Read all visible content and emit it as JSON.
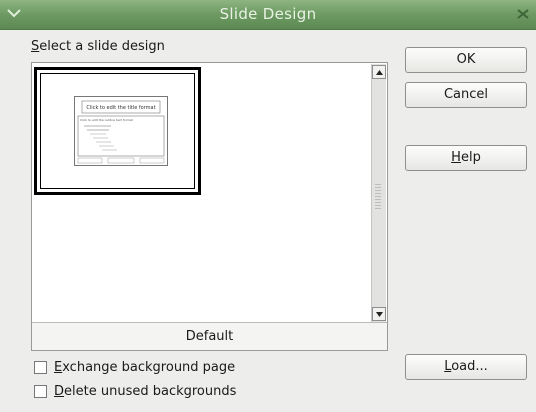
{
  "window": {
    "title": "Slide Design",
    "menu_icon": "window-menu-icon",
    "close_icon": "close-icon"
  },
  "section": {
    "label_accel": "S",
    "label_rest": "elect a slide design"
  },
  "design_list": {
    "selected_design": "Default",
    "thumbnail_title_text": "Click to edit the title format",
    "thumbnail_outline_text": "Click to edit the outline text format"
  },
  "options": {
    "exchange_background": {
      "accel": "E",
      "rest": "xchange background page",
      "checked": false
    },
    "delete_unused": {
      "accel": "D",
      "rest": "elete unused backgrounds",
      "checked": false
    }
  },
  "buttons": {
    "ok": "OK",
    "cancel": "Cancel",
    "help_accel": "H",
    "help_rest": "elp",
    "load_accel": "L",
    "load_rest": "oad..."
  },
  "colors": {
    "titlebar": "#6c9a62",
    "title_text": "#e9f2e4",
    "dialog_bg": "#ededeb"
  }
}
